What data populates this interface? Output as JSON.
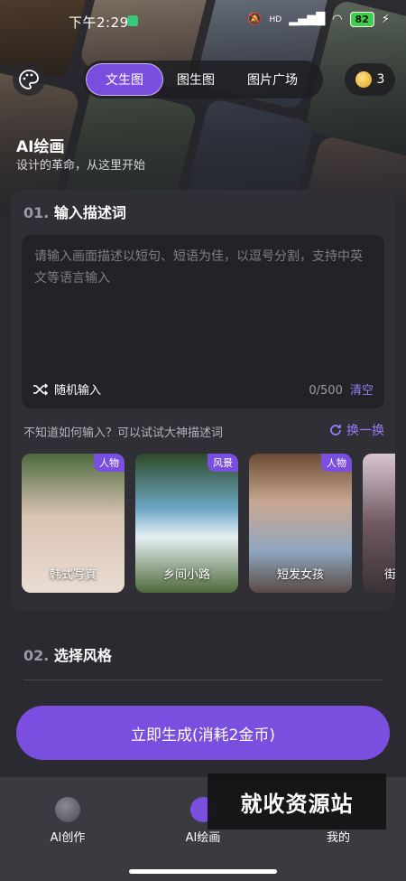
{
  "status": {
    "time": "下午2:29",
    "battery": "82",
    "network": "HD"
  },
  "tabs": [
    {
      "label": "文生图",
      "active": true
    },
    {
      "label": "图生图",
      "active": false
    },
    {
      "label": "图片广场",
      "active": false
    }
  ],
  "coins": "3",
  "hero": {
    "title": "AI绘画",
    "subtitle": "设计的革命，从这里开始"
  },
  "input_section": {
    "number": "01.",
    "title": "输入描述词",
    "placeholder": "请输入画面描述以短句、短语为佳，以逗号分割，支持中英文等语言输入",
    "random_label": "随机输入",
    "counter": "0/500",
    "clear_label": "清空"
  },
  "hint": {
    "text": "不知道如何输入？可以试试大神描述词",
    "refresh_label": "换一换"
  },
  "gallery": [
    {
      "tag": "人物",
      "label": "韩式写真"
    },
    {
      "tag": "风景",
      "label": "乡间小路"
    },
    {
      "tag": "人物",
      "label": "短发女孩"
    },
    {
      "tag": "",
      "label": "街"
    }
  ],
  "style_section": {
    "number": "02.",
    "title": "选择风格"
  },
  "generate_button": "立即生成(消耗2金币)",
  "nav": [
    {
      "label": "AI创作",
      "icon": "ai-create-icon"
    },
    {
      "label": "AI绘画",
      "icon": "ai-paint-icon"
    },
    {
      "label": "我的",
      "icon": "profile-icon"
    }
  ],
  "watermark": "就收资源站",
  "colors": {
    "accent": "#7a4fe0",
    "accent_text": "#9a7cf5",
    "background": "#2a2a30"
  }
}
